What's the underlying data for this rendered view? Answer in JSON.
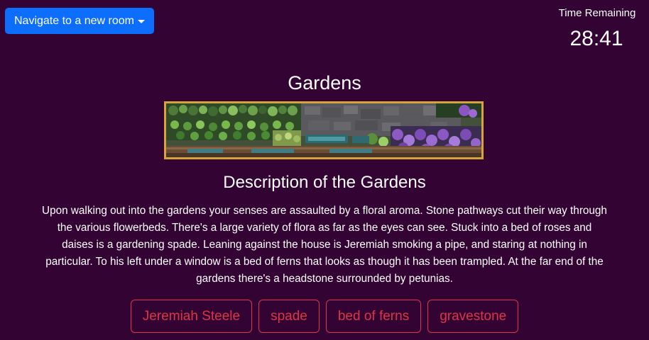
{
  "nav": {
    "label": "Navigate to a new room",
    "accent_color": "#0d6efd"
  },
  "timer": {
    "label": "Time Remaining",
    "value": "28:41"
  },
  "room": {
    "title": "Gardens",
    "image_alt": "garden banner illustration",
    "description_heading": "Description of the Gardens",
    "description": "Upon walking out into the gardens your senses are assaulted by a floral aroma. Stone pathways cut their way through the various flowerbeds. There's a large variety of flora as far as the eyes can see. Stuck into a bed of roses and daises is a gardening spade. Leaning against the house is Jeremiah smoking a pipe, and staring at nothing in particular. To his left under a window is a bed of ferns that looks as though it has been trampled. At the far end of the gardens there's a headstone surrounded by petunias."
  },
  "items": [
    {
      "label": "Jeremiah Steele"
    },
    {
      "label": "spade"
    },
    {
      "label": "bed of ferns"
    },
    {
      "label": "gravestone"
    }
  ],
  "colors": {
    "background": "#330433",
    "item_outline": "#dc3545",
    "banner_border": "#d6a53a"
  }
}
